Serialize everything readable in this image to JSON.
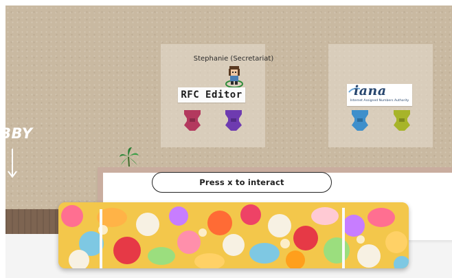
{
  "scene": {
    "lobby_label": "BBY",
    "avatar": {
      "name": "Stephanie (Secretariat)"
    },
    "rooms": [
      {
        "id": "rfc-editor",
        "sign_text": "RFC Editor",
        "chair_colors": [
          "#b3395e",
          "#6e3bb0"
        ]
      },
      {
        "id": "iana",
        "sign_text": "iana",
        "sign_subtitle": "Internet Assigned Numbers Authority",
        "chair_colors": [
          "#3f8fcb",
          "#a7b429"
        ]
      }
    ]
  },
  "prompt": {
    "interact_text": "Press x to interact"
  },
  "colors": {
    "floor": "#c9b9a1",
    "room_overlay": "#e4dacb",
    "panel_border": "#c9ad9f",
    "iana_blue": "#27466e"
  },
  "icons": {
    "lobby_arrow": "down-arrow-icon",
    "avatar": "pixel-avatar-icon",
    "chair": "chair-icon",
    "plant": "palm-plant-icon"
  }
}
